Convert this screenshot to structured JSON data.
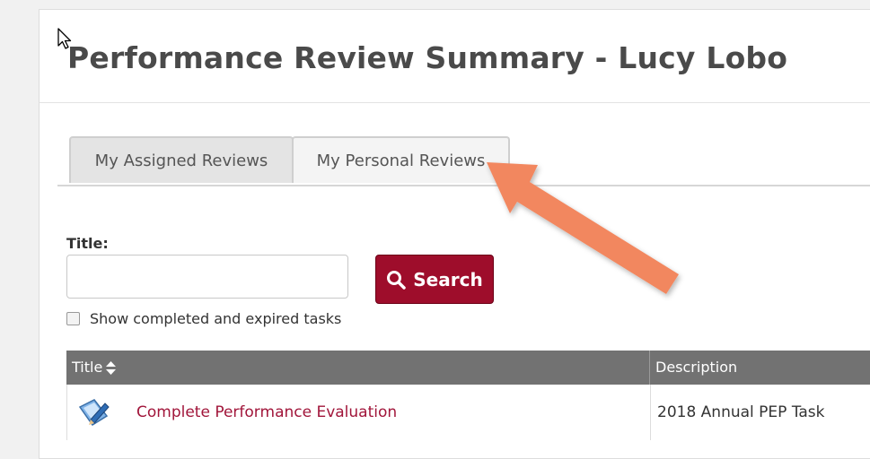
{
  "page": {
    "title": "Performance Review Summary - Lucy Lobo"
  },
  "tabs": [
    {
      "label": "My Assigned Reviews",
      "active": true
    },
    {
      "label": "My Personal Reviews",
      "active": false
    }
  ],
  "search": {
    "title_label": "Title:",
    "title_value": "",
    "button_label": "Search",
    "button_icon": "search-icon",
    "show_completed_label": "Show completed and expired tasks",
    "show_completed_checked": false
  },
  "table": {
    "columns": [
      {
        "label": "Title",
        "sortable": true
      },
      {
        "label": "Description"
      }
    ],
    "rows": [
      {
        "icon": "document-pencil-icon",
        "title": "Complete Performance Evaluation",
        "description": "2018 Annual PEP Task"
      }
    ]
  },
  "colors": {
    "accent": "#9e0d2b",
    "link": "#a1153a",
    "header_bg": "#727272",
    "annotation_arrow": "#f2875f"
  }
}
